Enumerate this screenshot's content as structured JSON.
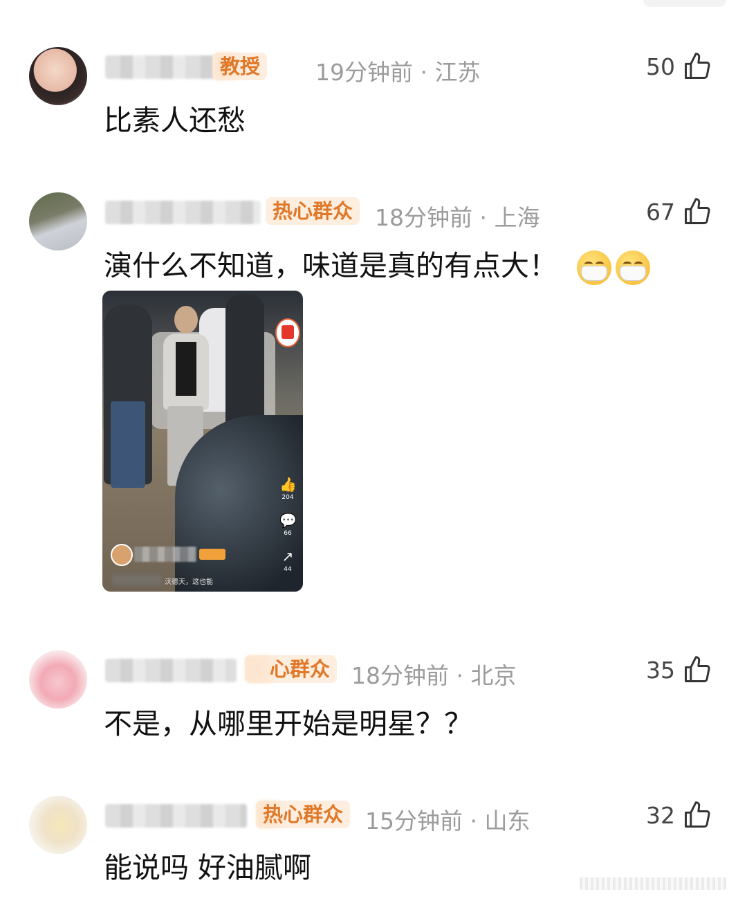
{
  "comments": [
    {
      "badge": "教授",
      "time": "19分钟前",
      "dot": "·",
      "location": "江苏",
      "likes": "50",
      "text": "比素人还愁"
    },
    {
      "badge": "热心群众",
      "time": "18分钟前",
      "dot": "·",
      "location": "上海",
      "likes": "67",
      "text": "演什么不知道，味道是真的有点大！",
      "emoji": "mask-face",
      "image": {
        "caption": "沃德天，这也能",
        "side_counts": [
          "204",
          "66",
          "44"
        ]
      }
    },
    {
      "badge": "心群众",
      "time": "18分钟前",
      "dot": "·",
      "location": "北京",
      "likes": "35",
      "text": "不是，从哪里开始是明星？？"
    },
    {
      "badge": "热心群众",
      "time": "15分钟前",
      "dot": "·",
      "location": "山东",
      "likes": "32",
      "text": "能说吗 好油腻啊"
    }
  ],
  "icons": {
    "like": "thumbs-up-icon",
    "accent": "#e07828",
    "meta_color": "#9b9b9b"
  }
}
